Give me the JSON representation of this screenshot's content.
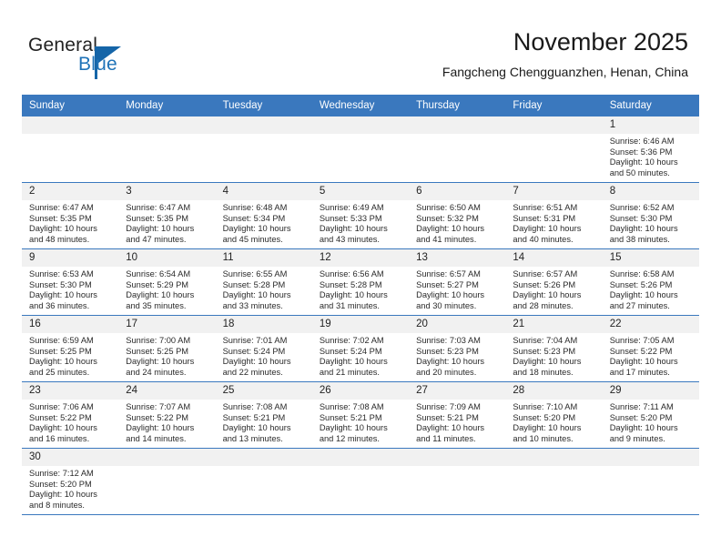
{
  "brand": {
    "name_part1": "General",
    "name_part2": "Blue",
    "logo_icon": "triangle-flag-icon"
  },
  "header": {
    "title": "November 2025",
    "subtitle": "Fangcheng Chengguanzhen, Henan, China"
  },
  "theme": {
    "header_blue": "#3a78be",
    "brand_blue": "#1f73b8",
    "daynum_band": "#f1f1f1",
    "text": "#2a2a2a"
  },
  "calendar": {
    "weekday_headers": [
      "Sunday",
      "Monday",
      "Tuesday",
      "Wednesday",
      "Thursday",
      "Friday",
      "Saturday"
    ],
    "labels": {
      "sunrise": "Sunrise:",
      "sunset": "Sunset:",
      "daylight": "Daylight:"
    },
    "weeks": [
      [
        {
          "blank": true
        },
        {
          "blank": true
        },
        {
          "blank": true
        },
        {
          "blank": true
        },
        {
          "blank": true
        },
        {
          "blank": true
        },
        {
          "day": "1",
          "sunrise": "Sunrise: 6:46 AM",
          "sunset": "Sunset: 5:36 PM",
          "daylight": "Daylight: 10 hours and 50 minutes."
        }
      ],
      [
        {
          "day": "2",
          "sunrise": "Sunrise: 6:47 AM",
          "sunset": "Sunset: 5:35 PM",
          "daylight": "Daylight: 10 hours and 48 minutes."
        },
        {
          "day": "3",
          "sunrise": "Sunrise: 6:47 AM",
          "sunset": "Sunset: 5:35 PM",
          "daylight": "Daylight: 10 hours and 47 minutes."
        },
        {
          "day": "4",
          "sunrise": "Sunrise: 6:48 AM",
          "sunset": "Sunset: 5:34 PM",
          "daylight": "Daylight: 10 hours and 45 minutes."
        },
        {
          "day": "5",
          "sunrise": "Sunrise: 6:49 AM",
          "sunset": "Sunset: 5:33 PM",
          "daylight": "Daylight: 10 hours and 43 minutes."
        },
        {
          "day": "6",
          "sunrise": "Sunrise: 6:50 AM",
          "sunset": "Sunset: 5:32 PM",
          "daylight": "Daylight: 10 hours and 41 minutes."
        },
        {
          "day": "7",
          "sunrise": "Sunrise: 6:51 AM",
          "sunset": "Sunset: 5:31 PM",
          "daylight": "Daylight: 10 hours and 40 minutes."
        },
        {
          "day": "8",
          "sunrise": "Sunrise: 6:52 AM",
          "sunset": "Sunset: 5:30 PM",
          "daylight": "Daylight: 10 hours and 38 minutes."
        }
      ],
      [
        {
          "day": "9",
          "sunrise": "Sunrise: 6:53 AM",
          "sunset": "Sunset: 5:30 PM",
          "daylight": "Daylight: 10 hours and 36 minutes."
        },
        {
          "day": "10",
          "sunrise": "Sunrise: 6:54 AM",
          "sunset": "Sunset: 5:29 PM",
          "daylight": "Daylight: 10 hours and 35 minutes."
        },
        {
          "day": "11",
          "sunrise": "Sunrise: 6:55 AM",
          "sunset": "Sunset: 5:28 PM",
          "daylight": "Daylight: 10 hours and 33 minutes."
        },
        {
          "day": "12",
          "sunrise": "Sunrise: 6:56 AM",
          "sunset": "Sunset: 5:28 PM",
          "daylight": "Daylight: 10 hours and 31 minutes."
        },
        {
          "day": "13",
          "sunrise": "Sunrise: 6:57 AM",
          "sunset": "Sunset: 5:27 PM",
          "daylight": "Daylight: 10 hours and 30 minutes."
        },
        {
          "day": "14",
          "sunrise": "Sunrise: 6:57 AM",
          "sunset": "Sunset: 5:26 PM",
          "daylight": "Daylight: 10 hours and 28 minutes."
        },
        {
          "day": "15",
          "sunrise": "Sunrise: 6:58 AM",
          "sunset": "Sunset: 5:26 PM",
          "daylight": "Daylight: 10 hours and 27 minutes."
        }
      ],
      [
        {
          "day": "16",
          "sunrise": "Sunrise: 6:59 AM",
          "sunset": "Sunset: 5:25 PM",
          "daylight": "Daylight: 10 hours and 25 minutes."
        },
        {
          "day": "17",
          "sunrise": "Sunrise: 7:00 AM",
          "sunset": "Sunset: 5:25 PM",
          "daylight": "Daylight: 10 hours and 24 minutes."
        },
        {
          "day": "18",
          "sunrise": "Sunrise: 7:01 AM",
          "sunset": "Sunset: 5:24 PM",
          "daylight": "Daylight: 10 hours and 22 minutes."
        },
        {
          "day": "19",
          "sunrise": "Sunrise: 7:02 AM",
          "sunset": "Sunset: 5:24 PM",
          "daylight": "Daylight: 10 hours and 21 minutes."
        },
        {
          "day": "20",
          "sunrise": "Sunrise: 7:03 AM",
          "sunset": "Sunset: 5:23 PM",
          "daylight": "Daylight: 10 hours and 20 minutes."
        },
        {
          "day": "21",
          "sunrise": "Sunrise: 7:04 AM",
          "sunset": "Sunset: 5:23 PM",
          "daylight": "Daylight: 10 hours and 18 minutes."
        },
        {
          "day": "22",
          "sunrise": "Sunrise: 7:05 AM",
          "sunset": "Sunset: 5:22 PM",
          "daylight": "Daylight: 10 hours and 17 minutes."
        }
      ],
      [
        {
          "day": "23",
          "sunrise": "Sunrise: 7:06 AM",
          "sunset": "Sunset: 5:22 PM",
          "daylight": "Daylight: 10 hours and 16 minutes."
        },
        {
          "day": "24",
          "sunrise": "Sunrise: 7:07 AM",
          "sunset": "Sunset: 5:22 PM",
          "daylight": "Daylight: 10 hours and 14 minutes."
        },
        {
          "day": "25",
          "sunrise": "Sunrise: 7:08 AM",
          "sunset": "Sunset: 5:21 PM",
          "daylight": "Daylight: 10 hours and 13 minutes."
        },
        {
          "day": "26",
          "sunrise": "Sunrise: 7:08 AM",
          "sunset": "Sunset: 5:21 PM",
          "daylight": "Daylight: 10 hours and 12 minutes."
        },
        {
          "day": "27",
          "sunrise": "Sunrise: 7:09 AM",
          "sunset": "Sunset: 5:21 PM",
          "daylight": "Daylight: 10 hours and 11 minutes."
        },
        {
          "day": "28",
          "sunrise": "Sunrise: 7:10 AM",
          "sunset": "Sunset: 5:20 PM",
          "daylight": "Daylight: 10 hours and 10 minutes."
        },
        {
          "day": "29",
          "sunrise": "Sunrise: 7:11 AM",
          "sunset": "Sunset: 5:20 PM",
          "daylight": "Daylight: 10 hours and 9 minutes."
        }
      ],
      [
        {
          "day": "30",
          "sunrise": "Sunrise: 7:12 AM",
          "sunset": "Sunset: 5:20 PM",
          "daylight": "Daylight: 10 hours and 8 minutes."
        },
        {
          "blank": true
        },
        {
          "blank": true
        },
        {
          "blank": true
        },
        {
          "blank": true
        },
        {
          "blank": true
        },
        {
          "blank": true
        }
      ]
    ]
  }
}
